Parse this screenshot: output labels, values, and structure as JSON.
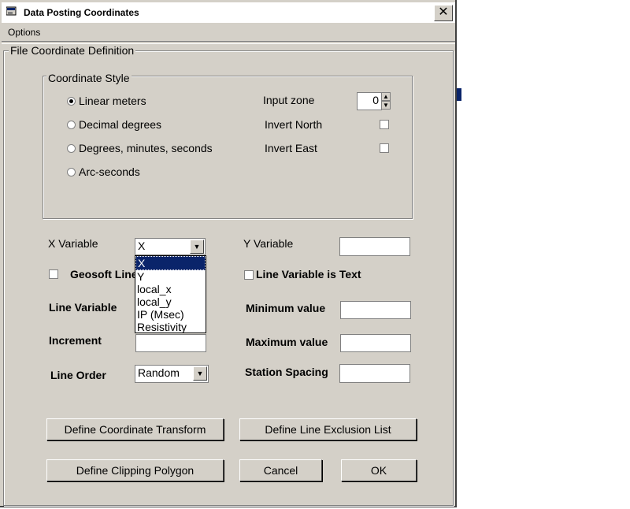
{
  "window": {
    "title": "Data Posting Coordinates"
  },
  "menu": {
    "options": "Options"
  },
  "file_group": {
    "label": "File Coordinate Definition"
  },
  "coord_style": {
    "label": "Coordinate Style",
    "radios": [
      {
        "label": "Linear meters",
        "checked": true
      },
      {
        "label": "Decimal degrees",
        "checked": false
      },
      {
        "label": "Degrees, minutes, seconds",
        "checked": false
      },
      {
        "label": "Arc-seconds",
        "checked": false
      }
    ],
    "input_zone_label": "Input zone",
    "input_zone_value": "0",
    "invert_north_label": "Invert North",
    "invert_east_label": "Invert East"
  },
  "x_variable": {
    "label": "X Variable",
    "value": "X",
    "options": [
      "X",
      "Y",
      "local_x",
      "local_y",
      "IP (Msec)",
      "Resistivity"
    ]
  },
  "y_variable": {
    "label": "Y Variable",
    "value": ""
  },
  "geosoft_label": "Geosoft Line",
  "line_variable_is_text_label": "Line Variable is Text",
  "line_variable_label": "Line Variable",
  "minimum_value_label": "Minimum value",
  "increment_label": "Increment",
  "maximum_value_label": "Maximum value",
  "line_order": {
    "label": "Line Order",
    "value": "Random"
  },
  "station_spacing_label": "Station Spacing",
  "buttons": {
    "coordinate_transform": "Define Coordinate Transform",
    "line_exclusion": "Define Line Exclusion List",
    "clipping_polygon": "Define Clipping Polygon",
    "cancel": "Cancel",
    "ok": "OK"
  }
}
